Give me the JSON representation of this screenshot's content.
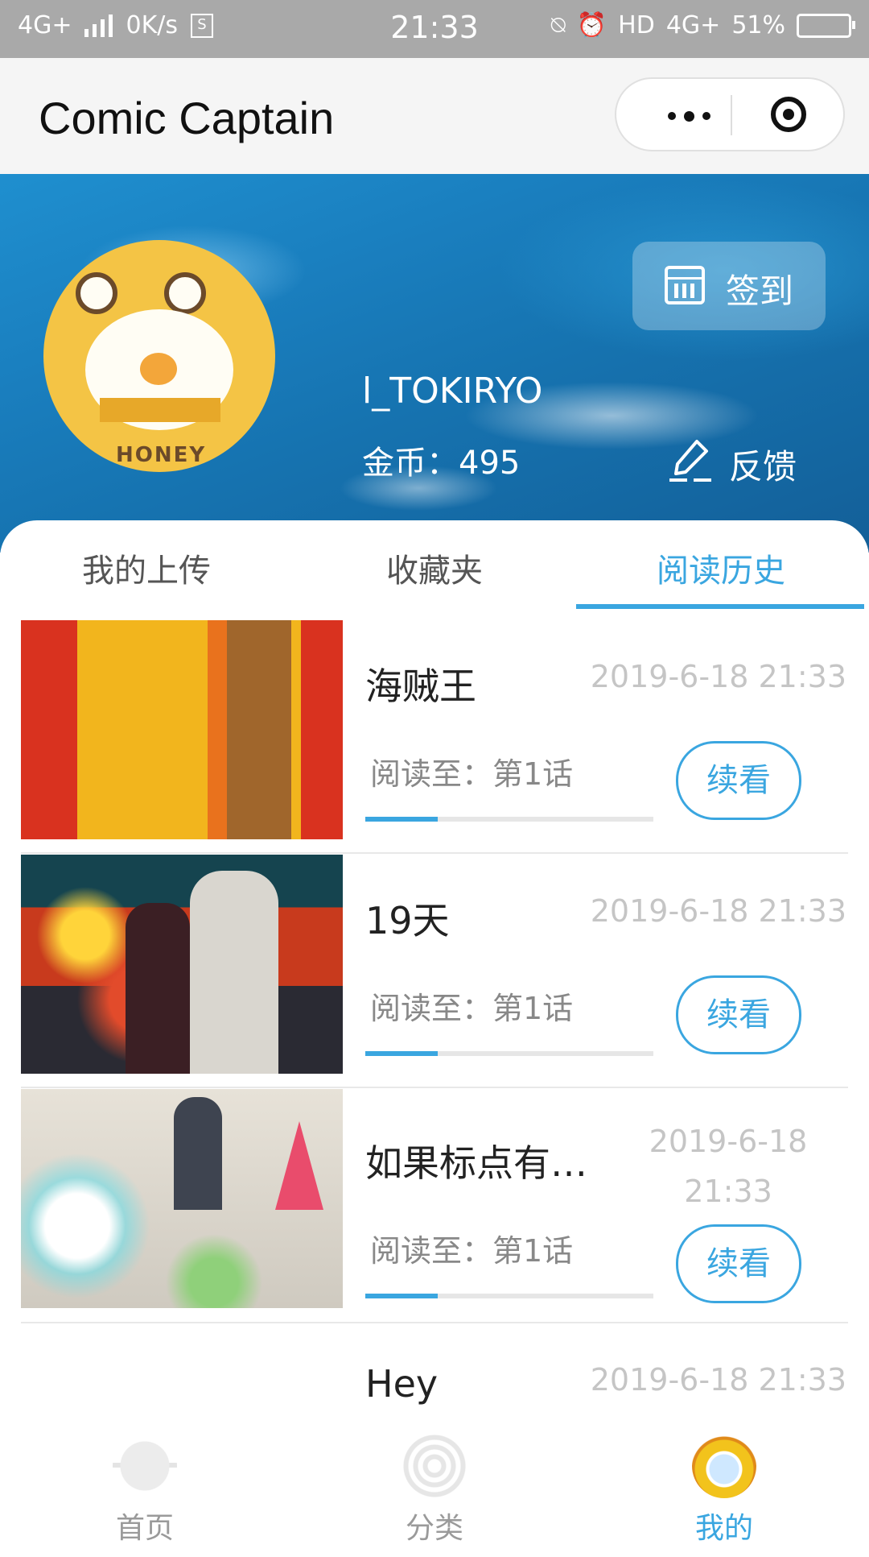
{
  "status_bar": {
    "network": "4G+",
    "speed": "0K/s",
    "time": "21:33",
    "hd": "HD",
    "network2": "4G+",
    "battery": "51%"
  },
  "app": {
    "title": "Comic Captain"
  },
  "profile": {
    "username": "l_TOKIRYO",
    "coins": "金币：495",
    "avatar_text": "HONEY",
    "signin_label": "签到",
    "feedback_label": "反馈"
  },
  "tabs": [
    {
      "label": "我的上传",
      "active": false
    },
    {
      "label": "收藏夹",
      "active": false
    },
    {
      "label": "阅读历史",
      "active": true
    }
  ],
  "history": [
    {
      "title": "海贼王",
      "time": "2019-6-18 21:33",
      "progress_label": "阅读至：第1话",
      "progress": 0.25,
      "button": "续看"
    },
    {
      "title": "19天",
      "time": "2019-6-18 21:33",
      "progress_label": "阅读至：第1话",
      "progress": 0.25,
      "button": "续看"
    },
    {
      "title": "如果标点有…",
      "time_line1": "2019-6-18",
      "time_line2": "21:33",
      "progress_label": "阅读至：第1话",
      "progress": 0.25,
      "button": "续看"
    },
    {
      "title": "Hey",
      "time": "2019-6-18 21:33"
    }
  ],
  "bottom_nav": [
    {
      "label": "首页",
      "icon": "planet-icon",
      "active": false
    },
    {
      "label": "分类",
      "icon": "galaxy-icon",
      "active": false
    },
    {
      "label": "我的",
      "icon": "astronaut-icon",
      "active": true
    }
  ],
  "colors": {
    "accent": "#3aa6e0",
    "status_bar": "#a9a9a9",
    "header_blue": "#1a7fbf"
  }
}
